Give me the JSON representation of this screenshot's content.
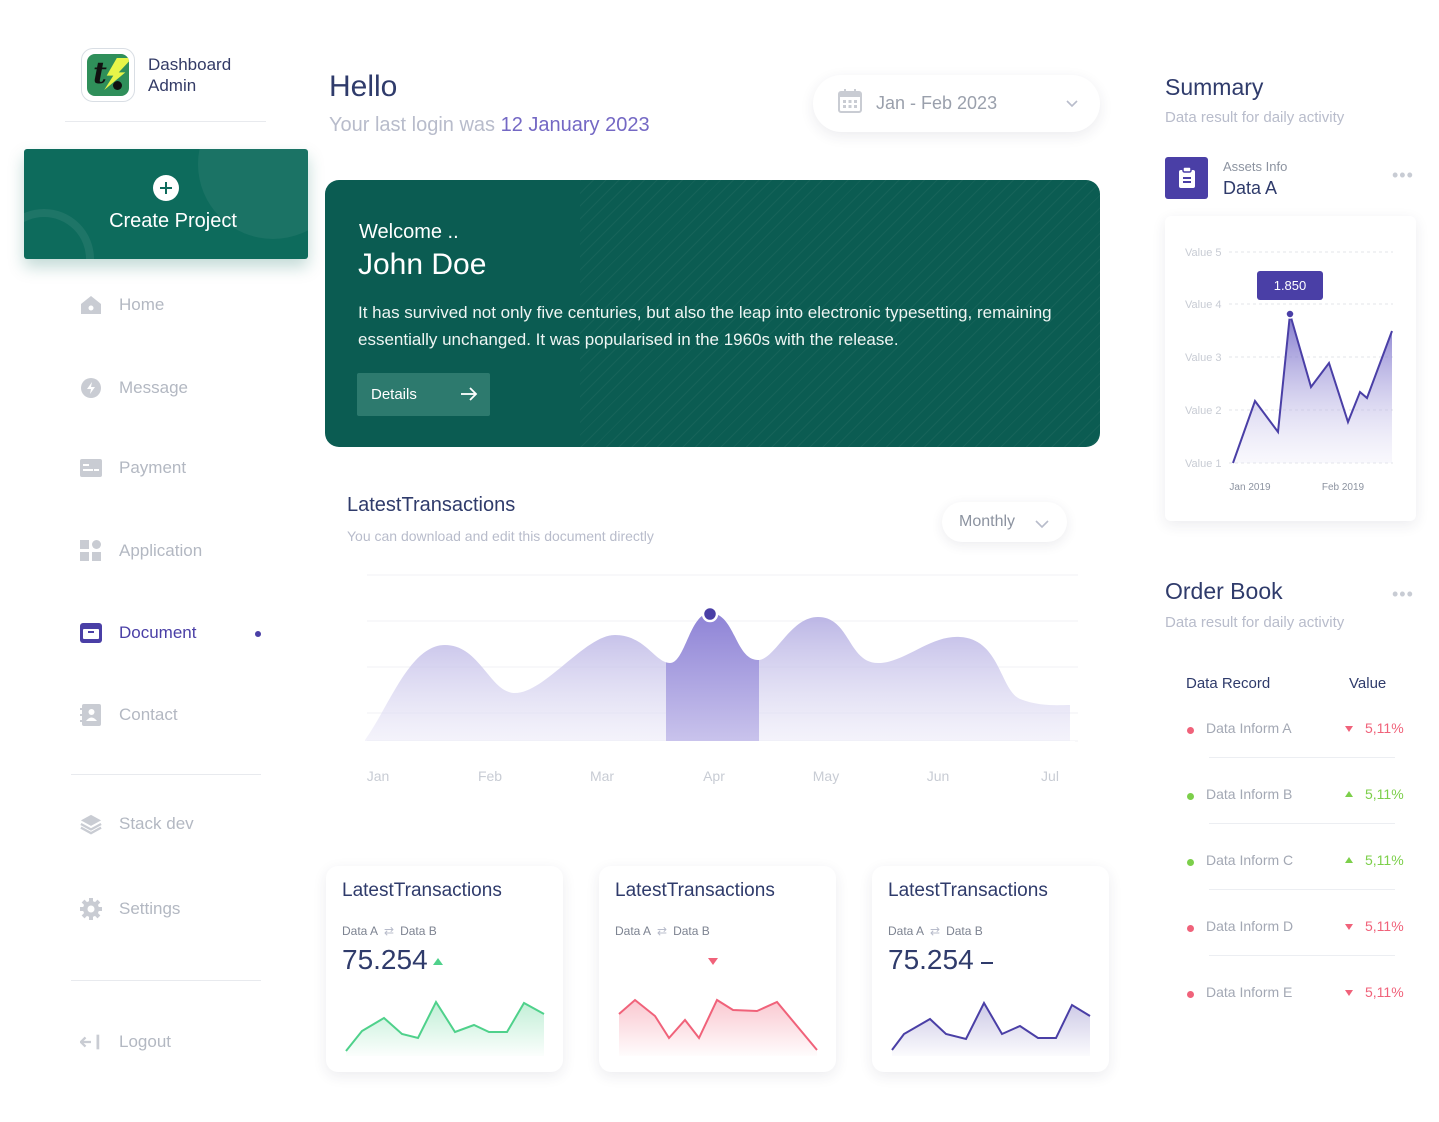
{
  "brand": {
    "line1": "Dashboard",
    "line2": "Admin"
  },
  "sidebar": {
    "create_label": "Create Project",
    "items": [
      {
        "label": "Home",
        "icon": "home-icon"
      },
      {
        "label": "Message",
        "icon": "lightning-icon"
      },
      {
        "label": "Payment",
        "icon": "card-icon"
      },
      {
        "label": "Application",
        "icon": "grid-icon"
      },
      {
        "label": "Document",
        "icon": "archive-icon",
        "active": true
      },
      {
        "label": "Contact",
        "icon": "contact-book-icon"
      },
      {
        "label": "Stack dev",
        "icon": "layers-icon"
      },
      {
        "label": "Settings",
        "icon": "gear-icon"
      },
      {
        "label": "Logout",
        "icon": "logout-icon"
      }
    ]
  },
  "header": {
    "hello": "Hello",
    "last_login_prefix": "Your last login was ",
    "last_login_date": "12 January 2023",
    "date_range": "Jan - Feb 2023"
  },
  "welcome": {
    "greeting": "Welcome ..",
    "name": "John Doe",
    "body": "It has survived not only five centuries, but also the leap into electronic typesetting, remaining essentially unchanged. It was popularised in the 1960s with the release.",
    "button": "Details"
  },
  "transactions": {
    "title": "LatestTransactions",
    "subtitle": "You can download and edit this document directly",
    "period": "Monthly"
  },
  "mini_cards": [
    {
      "title": "LatestTransactions",
      "from": "Data A",
      "to": "Data B",
      "value": "75.254",
      "trend": "up",
      "color": "#4fd18b"
    },
    {
      "title": "LatestTransactions",
      "from": "Data A",
      "to": "Data B",
      "value": "",
      "trend": "down",
      "color": "#f0627a"
    },
    {
      "title": "LatestTransactions",
      "from": "Data A",
      "to": "Data B",
      "value": "75.254",
      "trend": "flat",
      "color": "#4a3fa6"
    }
  ],
  "summary": {
    "title": "Summary",
    "subtitle": "Data result for daily activity",
    "asset_label": "Assets Info",
    "asset_name": "Data A",
    "tooltip": "1.850"
  },
  "order_book": {
    "title": "Order Book",
    "subtitle": "Data result for daily activity",
    "col_record": "Data Record",
    "col_value": "Value",
    "rows": [
      {
        "name": "Data Inform A",
        "value": "5,11%",
        "trend": "down"
      },
      {
        "name": "Data Inform B",
        "value": "5,11%",
        "trend": "up"
      },
      {
        "name": "Data Inform C",
        "value": "5,11%",
        "trend": "up"
      },
      {
        "name": "Data Inform D",
        "value": "5,11%",
        "trend": "down"
      },
      {
        "name": "Data Inform E",
        "value": "5,11%",
        "trend": "down"
      }
    ]
  },
  "chart_data": [
    {
      "type": "area",
      "categories": [
        "Jan",
        "Feb",
        "Mar",
        "Apr",
        "May",
        "Jun",
        "Jul"
      ],
      "highlight": "Apr"
    },
    {
      "type": "area",
      "categories": [
        "Jan 2019",
        "Feb 2019"
      ],
      "y_tick_labels": [
        "Value 1",
        "Value 2",
        "Value 3",
        "Value 4",
        "Value 5"
      ],
      "tooltip": "1.850"
    }
  ]
}
